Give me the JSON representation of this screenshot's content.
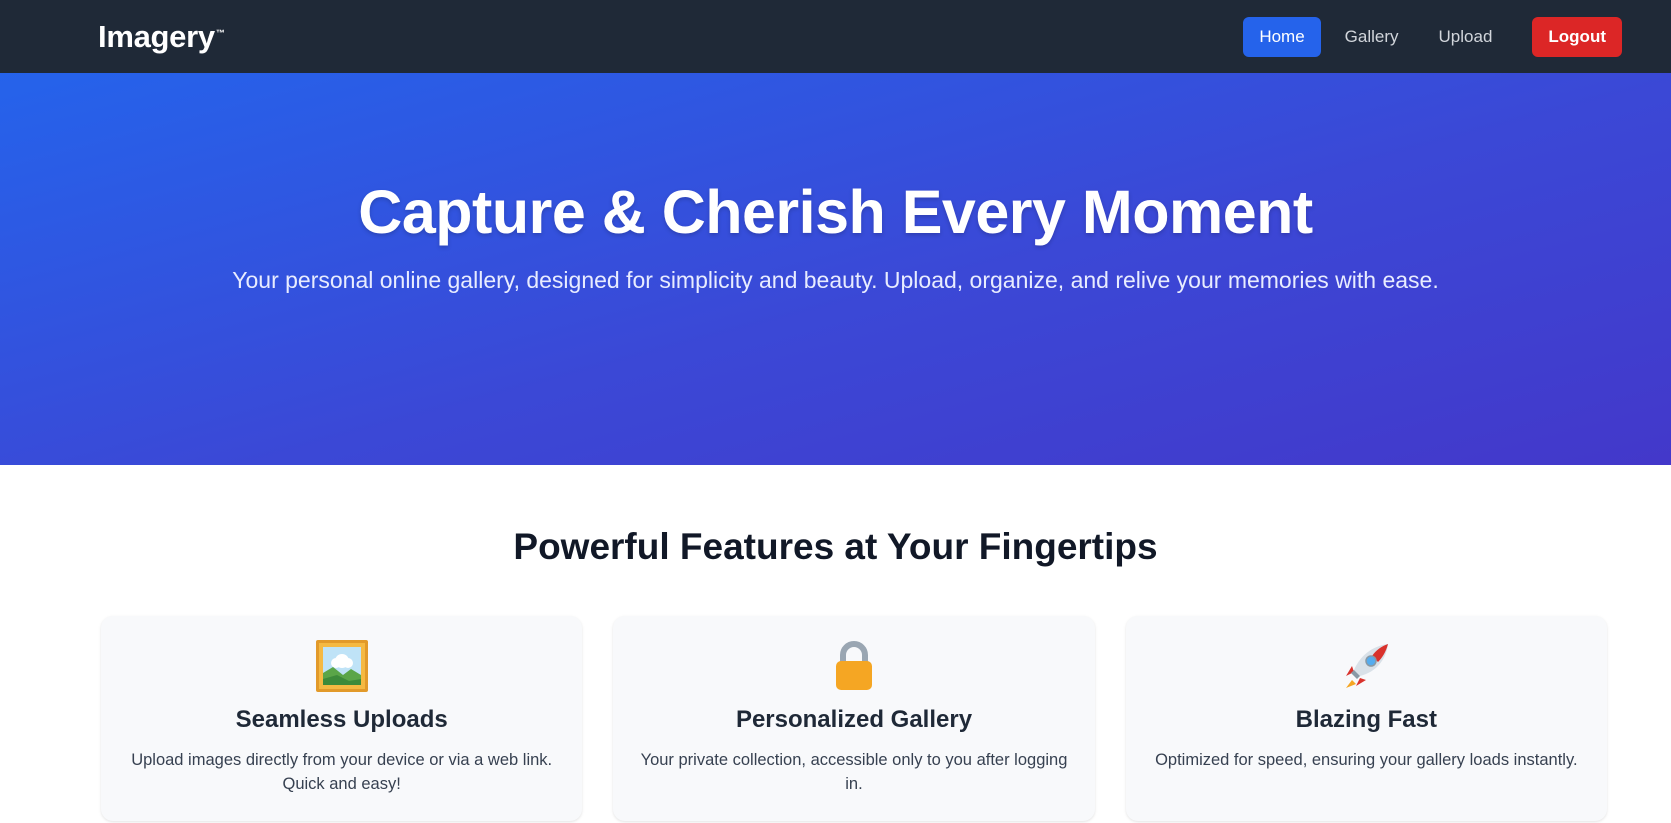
{
  "nav": {
    "brand": "Imagery",
    "brand_mark": "™",
    "links": [
      {
        "label": "Home",
        "active": true
      },
      {
        "label": "Gallery",
        "active": false
      },
      {
        "label": "Upload",
        "active": false
      }
    ],
    "logout_label": "Logout"
  },
  "hero": {
    "title": "Capture & Cherish Every Moment",
    "subtitle": "Your personal online gallery, designed for simplicity and beauty. Upload, organize, and relive your memories with ease."
  },
  "features": {
    "title": "Powerful Features at Your Fingertips",
    "cards": [
      {
        "icon": "framed-picture-icon",
        "title": "Seamless Uploads",
        "description": "Upload images directly from your device or via a web link. Quick and easy!"
      },
      {
        "icon": "lock-icon",
        "title": "Personalized Gallery",
        "description": "Your private collection, accessible only to you after logging in."
      },
      {
        "icon": "rocket-icon",
        "title": "Blazing Fast",
        "description": "Optimized for speed, ensuring your gallery loads instantly."
      }
    ]
  },
  "colors": {
    "navbar": "#1f2937",
    "primary": "#2563eb",
    "danger": "#dc2626",
    "hero_start": "#2563eb",
    "hero_end": "#4338ca"
  }
}
